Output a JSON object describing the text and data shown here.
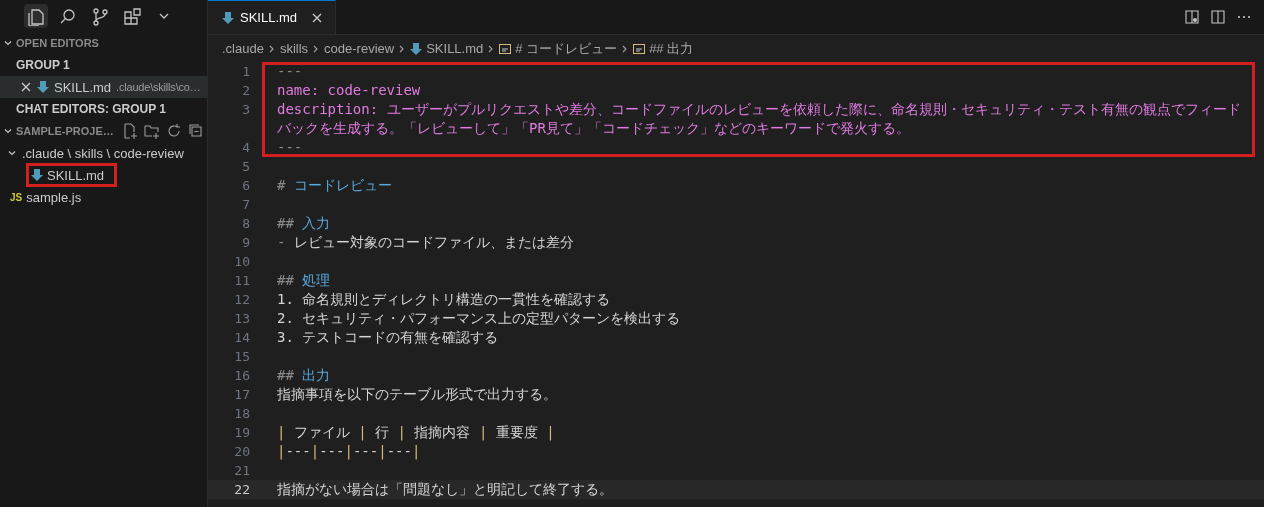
{
  "sidebar": {
    "activity_bar": [
      {
        "selected": true
      },
      {
        "selected": false
      },
      {
        "selected": false
      },
      {
        "selected": false
      },
      {
        "selected": false
      }
    ],
    "open_editors": {
      "title": "OPEN EDITORS",
      "expanded": true,
      "group": "GROUP 1",
      "files": [
        {
          "name": "SKILL.md",
          "path": ".claude\\skills\\co…",
          "selected": true
        }
      ]
    },
    "chat_editors": {
      "title": "CHAT EDITORS: GROUP 1"
    },
    "explorer": {
      "title": "SAMPLE-PROJE…",
      "expanded": true,
      "tree": [
        {
          "name": ".claude \\ skills \\ code-review",
          "kind": "folder",
          "expanded": true,
          "boxed": false,
          "children": [
            {
              "name": "SKILL.md",
              "kind": "markdown",
              "boxed": true
            }
          ]
        },
        {
          "name": "sample.js",
          "kind": "js",
          "icon_text": "JS",
          "boxed": false
        }
      ]
    }
  },
  "editor": {
    "tabs": [
      {
        "name": "SKILL.md",
        "selected": true
      }
    ],
    "breadcrumbs": [
      {
        "text": ".claude",
        "kind": "folder"
      },
      {
        "text": "skills",
        "kind": "folder"
      },
      {
        "text": "code-review",
        "kind": "folder"
      },
      {
        "text": "SKILL.md",
        "kind": "markdown"
      },
      {
        "text": "# コードレビュー",
        "kind": "symbol"
      },
      {
        "text": "## 出力",
        "kind": "symbol"
      }
    ],
    "lines": [
      {
        "number": "1",
        "boxed": true,
        "current": false,
        "tokens": [
          {
            "kind": "marker",
            "text": "---"
          }
        ]
      },
      {
        "number": "2",
        "boxed": true,
        "current": false,
        "tokens": [
          {
            "kind": "meta",
            "text": "name: code-review"
          }
        ]
      },
      {
        "number": "3",
        "boxed": true,
        "current": false,
        "tokens": [
          {
            "kind": "meta",
            "text": "description: ユーザーがプルリクエストや差分、コードファイルのレビューを依頼した際に、命名規則・セキュリティ・テスト有無の観点でフィードバックを生成する。「レビューして」「PR見て」「コードチェック」などのキーワードで発火する。"
          }
        ]
      },
      {
        "number": "4",
        "boxed": true,
        "current": false,
        "tokens": [
          {
            "kind": "marker",
            "text": "---"
          }
        ]
      },
      {
        "number": "5",
        "boxed": false,
        "current": false
      },
      {
        "number": "6",
        "boxed": false,
        "current": false,
        "tokens": [
          {
            "kind": "marker",
            "text": "#"
          },
          {
            "kind": "heading",
            "text": "コードレビュー"
          }
        ]
      },
      {
        "number": "7",
        "boxed": false,
        "current": false
      },
      {
        "number": "8",
        "boxed": false,
        "current": false,
        "tokens": [
          {
            "kind": "marker",
            "text": "##"
          },
          {
            "kind": "heading",
            "text": "入力"
          }
        ]
      },
      {
        "number": "9",
        "boxed": false,
        "current": false,
        "tokens": [
          {
            "kind": "marker",
            "text": "-"
          },
          {
            "kind": "text",
            "text": "レビュー対象のコードファイル、または差分"
          }
        ]
      },
      {
        "number": "10",
        "boxed": false,
        "current": false
      },
      {
        "number": "11",
        "boxed": false,
        "current": false,
        "tokens": [
          {
            "kind": "marker",
            "text": "##"
          },
          {
            "kind": "heading",
            "text": "処理"
          }
        ]
      },
      {
        "number": "12",
        "boxed": false,
        "current": false,
        "tokens": [
          {
            "kind": "text",
            "text": "1. 命名規則とディレクトリ構造の一貫性を確認する"
          }
        ]
      },
      {
        "number": "13",
        "boxed": false,
        "current": false,
        "tokens": [
          {
            "kind": "text",
            "text": "2. セキュリティ・パフォーマンス上の定型パターンを検出する"
          }
        ]
      },
      {
        "number": "14",
        "boxed": false,
        "current": false,
        "tokens": [
          {
            "kind": "text",
            "text": "3. テストコードの有無を確認する"
          }
        ]
      },
      {
        "number": "15",
        "boxed": false,
        "current": false
      },
      {
        "number": "16",
        "boxed": false,
        "current": false,
        "tokens": [
          {
            "kind": "marker",
            "text": "##"
          },
          {
            "kind": "heading",
            "text": "出力"
          }
        ]
      },
      {
        "number": "17",
        "boxed": false,
        "current": false,
        "tokens": [
          {
            "kind": "text",
            "text": "指摘事項を以下のテーブル形式で出力する。"
          }
        ]
      },
      {
        "number": "18",
        "boxed": false,
        "current": false
      },
      {
        "number": "19",
        "boxed": false,
        "current": false,
        "tokens": [
          {
            "kind": "pipe",
            "text": "|"
          },
          {
            "kind": "text",
            "text": " ファイル "
          },
          {
            "kind": "pipe",
            "text": "|"
          },
          {
            "kind": "text",
            "text": " 行 "
          },
          {
            "kind": "pipe",
            "text": "|"
          },
          {
            "kind": "text",
            "text": " 指摘内容 "
          },
          {
            "kind": "pipe",
            "text": "|"
          },
          {
            "kind": "text",
            "text": " 重要度 "
          },
          {
            "kind": "pipe",
            "text": "|"
          }
        ]
      },
      {
        "number": "20",
        "boxed": false,
        "current": false,
        "tokens": [
          {
            "kind": "pipe",
            "text": "|"
          },
          {
            "kind": "text",
            "text": "---"
          },
          {
            "kind": "pipe",
            "text": "|"
          },
          {
            "kind": "text",
            "text": "---"
          },
          {
            "kind": "pipe",
            "text": "|"
          },
          {
            "kind": "text",
            "text": "---"
          },
          {
            "kind": "pipe",
            "text": "|"
          },
          {
            "kind": "text",
            "text": "---"
          },
          {
            "kind": "pipe",
            "text": "|"
          }
        ]
      },
      {
        "number": "21",
        "boxed": false,
        "current": false
      },
      {
        "number": "22",
        "boxed": false,
        "current": true,
        "tokens": [
          {
            "kind": "text",
            "text": "指摘がない場合は「問題なし」と明記して終了する。"
          }
        ]
      }
    ]
  }
}
